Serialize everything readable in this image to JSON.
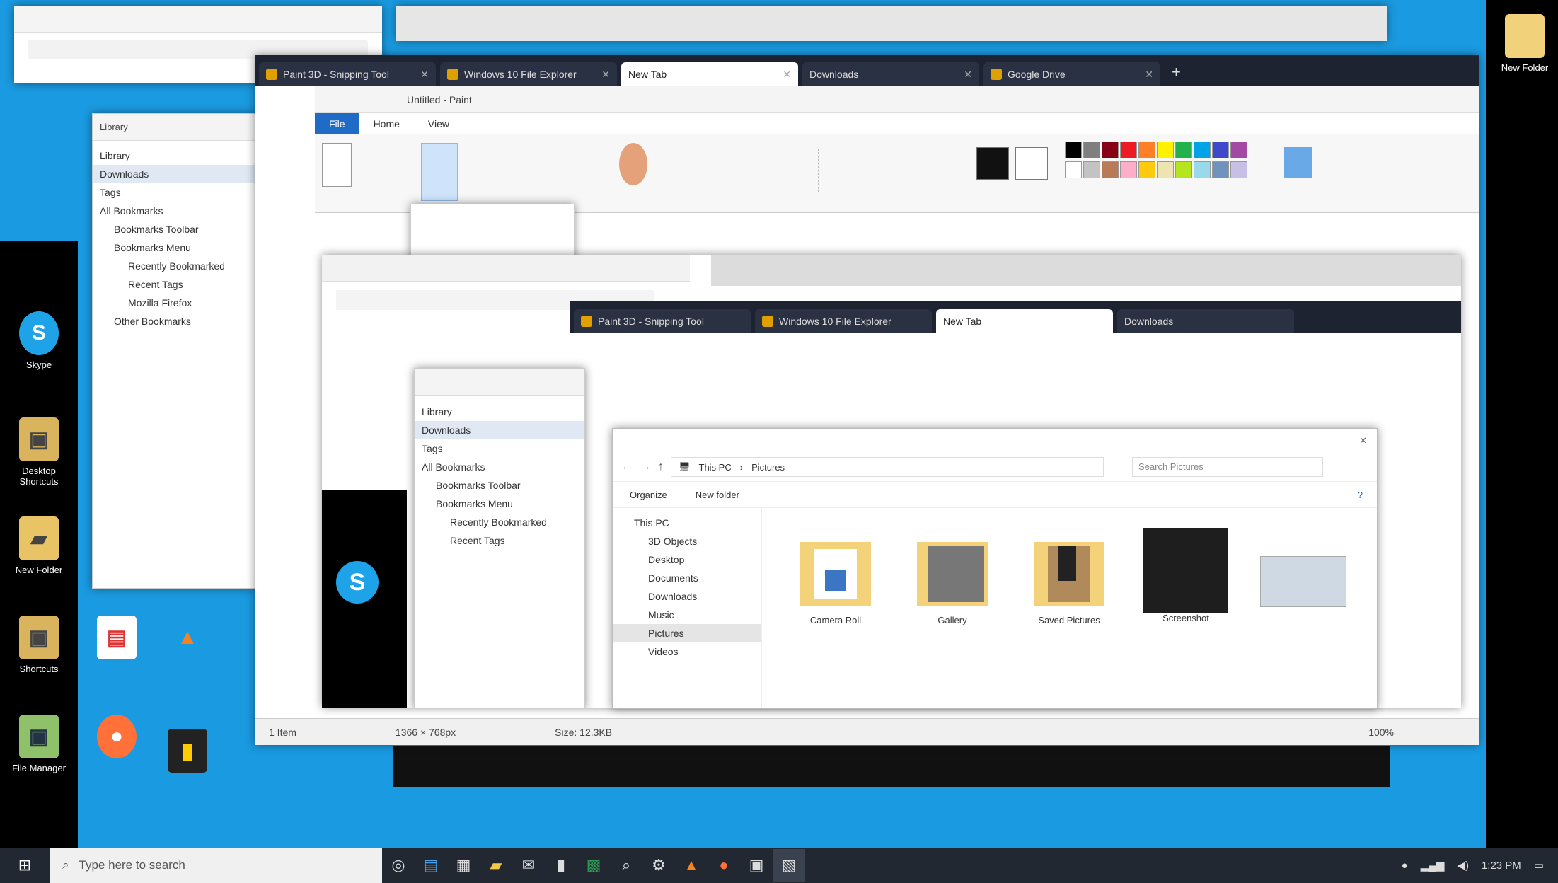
{
  "desktop": {
    "icons_left": [
      {
        "label": "Skype",
        "glyph": "S",
        "color": "#1fa3e8"
      },
      {
        "label": "Desktop Shortcuts",
        "glyph": "▣",
        "color": "#d9b45c"
      },
      {
        "label": "New Folder",
        "glyph": "▰",
        "color": "#e8c466"
      },
      {
        "label": "Shortcuts",
        "glyph": "▣",
        "color": "#d9b45c"
      },
      {
        "label": "File Manager",
        "glyph": "▣",
        "color": "#8fc16a"
      }
    ],
    "top_right_icon": {
      "label": "New Folder",
      "color": "#f1d27a"
    }
  },
  "back_window": {
    "tabs": [
      {
        "label": "Paint 3D - Snipping Tool",
        "active": false
      },
      {
        "label": "Windows 10 File Explorer",
        "active": false
      },
      {
        "label": "New Tab",
        "active": true
      },
      {
        "label": "Downloads",
        "active": false
      },
      {
        "label": "Google Drive",
        "active": false
      }
    ],
    "paint_title": "Untitled - Paint",
    "ribbon_tabs": [
      "File",
      "Home",
      "View"
    ],
    "sidebar": [
      "Library",
      "Downloads",
      "Tags",
      "All Bookmarks",
      "Bookmarks Toolbar",
      "Bookmarks Menu",
      "Recently Bookmarked",
      "Recent Tags",
      "Mozilla Firefox",
      "Other Bookmarks"
    ],
    "palette": [
      "#000000",
      "#7f7f7f",
      "#880015",
      "#ed1c24",
      "#ff7f27",
      "#fff200",
      "#22b14c",
      "#00a2e8",
      "#3f48cc",
      "#a349a4",
      "#ffffff",
      "#c3c3c3",
      "#b97a57",
      "#ffaec9",
      "#ffc90e",
      "#efe4b0",
      "#b5e61d",
      "#99d9ea",
      "#7092be",
      "#c8bfe7"
    ],
    "statusbar": [
      "1 Item",
      "1366 × 768px",
      "Size: 12.3KB",
      "100%"
    ]
  },
  "explorer": {
    "path": [
      "This PC",
      "Pictures"
    ],
    "search_placeholder": "Search Pictures",
    "toolbar": [
      "Organize",
      "New folder"
    ],
    "nav": [
      "This PC",
      "3D Objects",
      "Desktop",
      "Documents",
      "Downloads",
      "Music",
      "Pictures",
      "Videos"
    ],
    "items": [
      {
        "label": "Camera Roll",
        "kind": "folder"
      },
      {
        "label": "Gallery",
        "kind": "folder"
      },
      {
        "label": "Saved Pictures",
        "kind": "folder"
      },
      {
        "label": "Screenshot",
        "kind": "dark"
      },
      {
        "label": "",
        "kind": "image"
      }
    ]
  },
  "taskbar": {
    "search_placeholder": "Type here to search",
    "clock": "1:23 PM"
  }
}
